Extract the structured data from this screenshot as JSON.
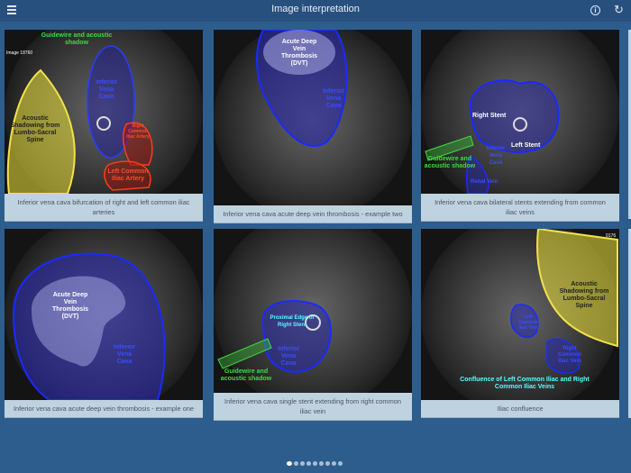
{
  "header": {
    "title": "Image interpretation",
    "menu_icon": "hamburger-icon",
    "info_icon": "info-icon",
    "refresh_icon": "refresh-icon"
  },
  "cards": [
    {
      "caption": "Inferior vena cava bifurcation of right and left common iliac arteries",
      "labels": [
        "Guidewire and acoustic shadow",
        "Image 18760",
        "Inferior Vena Cava",
        "Acoustic Shadowing from Lumbo-Sacral Spine",
        "Right Common Iliac Artery",
        "Left Common Iliac Artery"
      ]
    },
    {
      "caption": "Inferior vena cava acute deep vein thrombosis - example two",
      "labels": [
        "Acute Deep Vein Thrombosis (DVT)",
        "Inferior Vena Cava"
      ]
    },
    {
      "caption": "Inferior vena cava bilateral stents extending from common iliac veins",
      "labels": [
        "Right Stent",
        "Left Stent",
        "Guidewire and acoustic shadow",
        "Inferior Vena Cava",
        "Renal Vein"
      ]
    },
    {
      "caption": "Inferior vena cava acute deep vein thrombosis - example one",
      "labels": [
        "Acute Deep Vein Thrombosis (DVT)",
        "Inferior Vena Cava"
      ]
    },
    {
      "caption": "Inferior vena cava single stent extending from right common iliac vein",
      "labels": [
        "Proximal Edge of Right Stent",
        "Inferior Vena Cava",
        "Guidewire and acoustic shadow"
      ]
    },
    {
      "caption": "Iliac confluence",
      "labels": [
        "0176",
        "Acoustic Shadowing from Lumbo-Sacral Spine",
        "Left Common Iliac Vein",
        "Right Common Iliac Vein",
        "Confluence of Left Common Iliac and Right Common Iliac Veins"
      ]
    }
  ],
  "pagination": {
    "total": 9,
    "current": 1
  }
}
